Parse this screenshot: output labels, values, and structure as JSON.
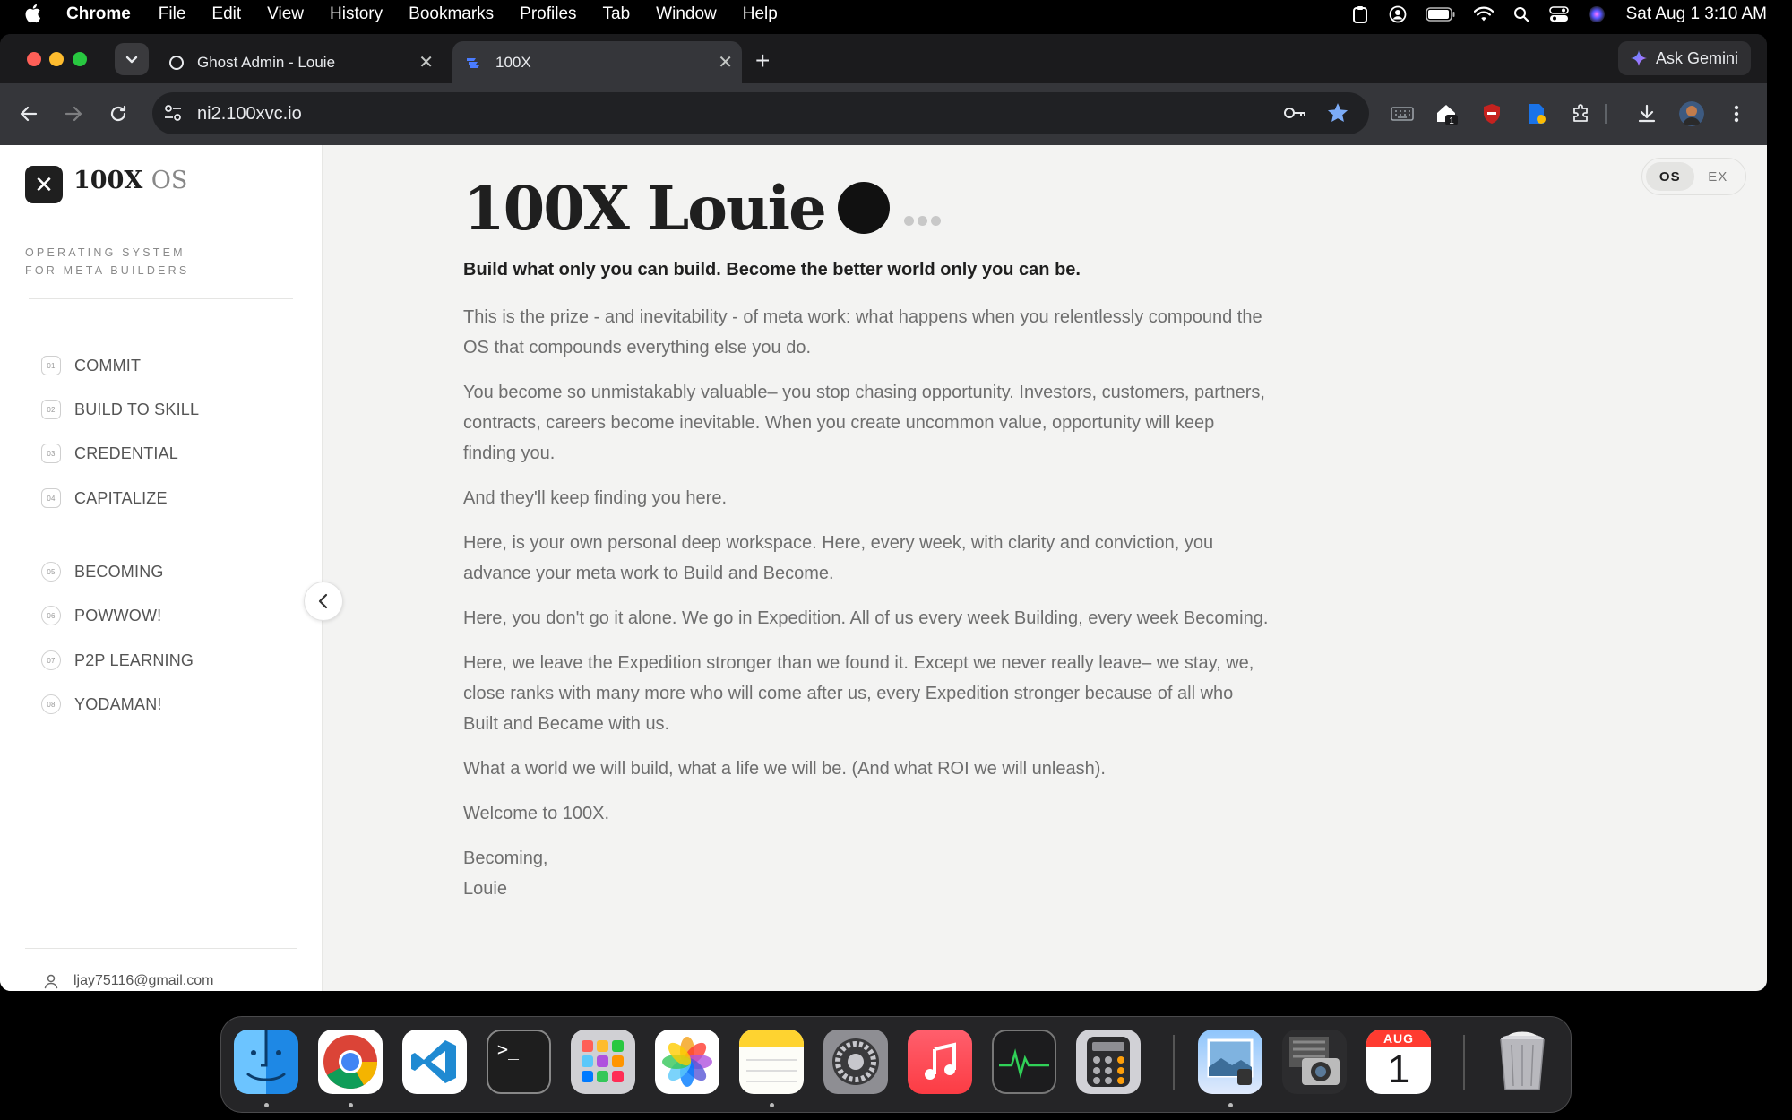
{
  "menubar": {
    "app": "Chrome",
    "items": [
      "File",
      "Edit",
      "View",
      "History",
      "Bookmarks",
      "Profiles",
      "Tab",
      "Window",
      "Help"
    ],
    "clock": "Sat Aug 1  3:10 AM"
  },
  "browser": {
    "tabs": [
      {
        "title": "Ghost Admin - Louie",
        "active": false
      },
      {
        "title": "100X",
        "active": true
      }
    ],
    "gemini_label": "Ask Gemini",
    "url": "ni2.100xvc.io"
  },
  "sidebar": {
    "logo_mark": "✕",
    "brand": "100X",
    "brand_suffix": "OS",
    "tagline_1": "OPERATING SYSTEM",
    "tagline_2": "FOR META BUILDERS",
    "nav": [
      {
        "num": "01",
        "label": "COMMIT"
      },
      {
        "num": "02",
        "label": "BUILD TO SKILL"
      },
      {
        "num": "03",
        "label": "CREDENTIAL"
      },
      {
        "num": "04",
        "label": "CAPITALIZE"
      },
      {
        "num": "05",
        "label": "BECOMING"
      },
      {
        "num": "06",
        "label": "POWWOW!"
      },
      {
        "num": "07",
        "label": "P2P LEARNING"
      },
      {
        "num": "08",
        "label": "YODAMAN!"
      }
    ],
    "user_email": "ljay75116@gmail.com"
  },
  "mode_toggle": {
    "os": "OS",
    "ex": "EX",
    "selected": "OS"
  },
  "main": {
    "title": "100X Louie",
    "lead": "Build what only you can build. Become the better world only you can be.",
    "paragraphs": [
      "This is the prize - and inevitability - of meta work: what happens when you relentlessly compound the OS that compounds everything else you do.",
      "You become so unmistakably valuable– you stop chasing opportunity. Investors, customers, partners, contracts, careers become inevitable. When you create uncommon value, opportunity will keep finding you.",
      "And they'll keep finding you here.",
      "Here, is your own personal deep workspace. Here, every week, with clarity and conviction, you advance your meta work to Build and Become.",
      "Here, you don't go it alone. We go in Expedition. All of us every week Building, every week Becoming.",
      "Here, we leave the Expedition stronger than we found it. Except we never really leave– we stay, we, close ranks with many more who will come after us, every Expedition stronger because of all who Built and Became with us.",
      "What a world we will build, what a life we will be. (And what ROI we will unleash).",
      "Welcome to 100X."
    ],
    "signoff_1": "Becoming,",
    "signoff_2": "Louie"
  },
  "dock": {
    "apps": [
      "Finder",
      "Google Chrome",
      "Visual Studio Code",
      "Terminal",
      "Launchpad",
      "Photos",
      "Notes",
      "System Settings",
      "Music",
      "Activity Monitor",
      "Calculator",
      "Preview",
      "Image Capture",
      "Calendar",
      "Trash"
    ],
    "calendar_month": "AUG",
    "calendar_day": "1"
  },
  "colors": {
    "page_bg": "#f3f3f2",
    "sidebar_bg": "#ffffff",
    "text_dark": "#1f1f1f",
    "text_muted": "#6e6e6e",
    "chrome_dark": "#202124",
    "chrome_toolbar": "#35363a",
    "star_blue": "#7cacf8"
  }
}
